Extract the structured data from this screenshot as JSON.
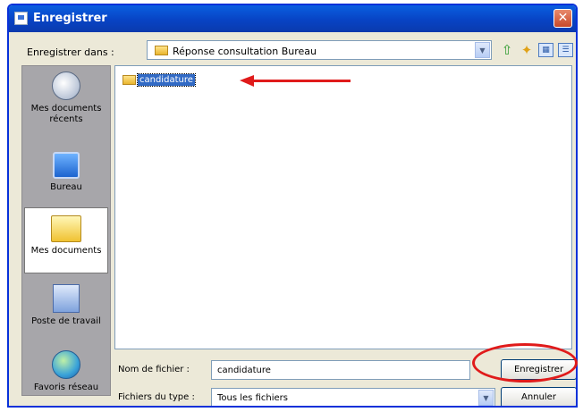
{
  "window": {
    "title": "Enregistrer"
  },
  "toolbar": {
    "save_in_label": "Enregistrer dans :",
    "save_in_value": "Réponse consultation Bureau",
    "icons": [
      "up-folder-icon",
      "new-folder-icon",
      "view-menu-icon",
      "tools-icon"
    ]
  },
  "sidebar": {
    "items": [
      {
        "label": "Mes documents récents",
        "icon": "recent-documents-icon"
      },
      {
        "label": "Bureau",
        "icon": "desktop-icon"
      },
      {
        "label": "Mes documents",
        "icon": "my-documents-icon",
        "selected": true
      },
      {
        "label": "Poste de travail",
        "icon": "my-computer-icon"
      },
      {
        "label": "Favoris réseau",
        "icon": "network-places-icon"
      }
    ]
  },
  "file_list": {
    "items": [
      {
        "name": "candidature",
        "type": "folder",
        "selected": true
      }
    ]
  },
  "form": {
    "file_name_label": "Nom de fichier :",
    "file_name_value": "candidature",
    "file_type_label": "Fichiers du type :",
    "file_type_value": "Tous les fichiers"
  },
  "buttons": {
    "save": "Enregistrer",
    "cancel": "Annuler"
  },
  "annotations": {
    "color": "#e01b1b"
  }
}
